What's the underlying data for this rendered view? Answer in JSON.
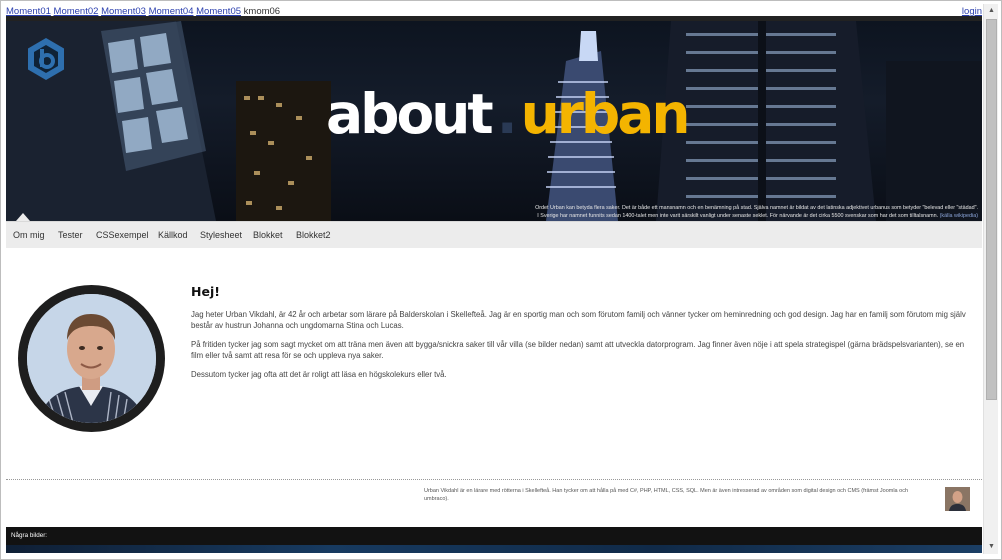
{
  "topbar": {
    "links": [
      "Moment01",
      "Moment02",
      "Moment03",
      "Moment04",
      "Moment05"
    ],
    "current": "kmom06",
    "login": "login"
  },
  "header": {
    "logo_icon": "hexagon-b-logo",
    "title_part1": "about",
    "title_dot": ".",
    "title_part2": "urban",
    "title_colors": {
      "part1": "#ffffff",
      "part2": "#f4b400"
    },
    "caption_line1": "Ordet Urban kan betyda flera saker. Det är både ett mansnamn och en benämning på stad. Själva namnet är bildat av det latinska adjektivet urbanus som betyder \"belevad eller \"städad\".",
    "caption_line2": "I Sverige har namnet funnits sedan 1400-talet men inte varit särskilt vanligt under senaste seklet. För närvande är det cirka 5500 svenskar som har det som tilltalsnamn.",
    "caption_link": "(källa wikipedia)"
  },
  "nav": {
    "items": [
      "Om mig",
      "Tester",
      "CSSexempel",
      "Källkod",
      "Stylesheet",
      "Blokket",
      "Blokket2"
    ]
  },
  "main": {
    "heading": "Hej!",
    "paragraphs": [
      "Jag heter Urban Vikdahl, är 42 år och arbetar som lärare på Balderskolan i Skellefteå. Jag är en sportig man och som förutom familj och vänner tycker om heminredning och god design. Jag har en familj som förutom mig själv består av hustrun Johanna och ungdomarna Stina och Lucas.",
      "På fritiden tycker jag som sagt mycket om att träna men även att bygga/snickra saker till vår villa (se bilder nedan) samt att utveckla datorprogram. Jag finner även nöje i att spela strategispel (gärna brädspelsvarianten), se en film eller två samt att resa för se och uppleva nya saker.",
      "Dessutom tycker jag ofta att det är roligt att läsa en högskolekurs eller två."
    ]
  },
  "footer": {
    "text": "Urban Vikdahl är en lärare med rötterna i Skellefteå. Han tycker om att hålla på med C#, PHP, HTML, CSS, SQL. Men är även intresserad av områden som digital design och CMS (främst Joomla och umbraco).",
    "bottom_label": "Några bilder:"
  },
  "scrollbar": {
    "up_icon": "▲",
    "down_icon": "▼"
  },
  "colors": {
    "accent": "#f4b400",
    "dark": "#121212",
    "nav_bg": "#ececec",
    "link": "#2b3fae"
  }
}
